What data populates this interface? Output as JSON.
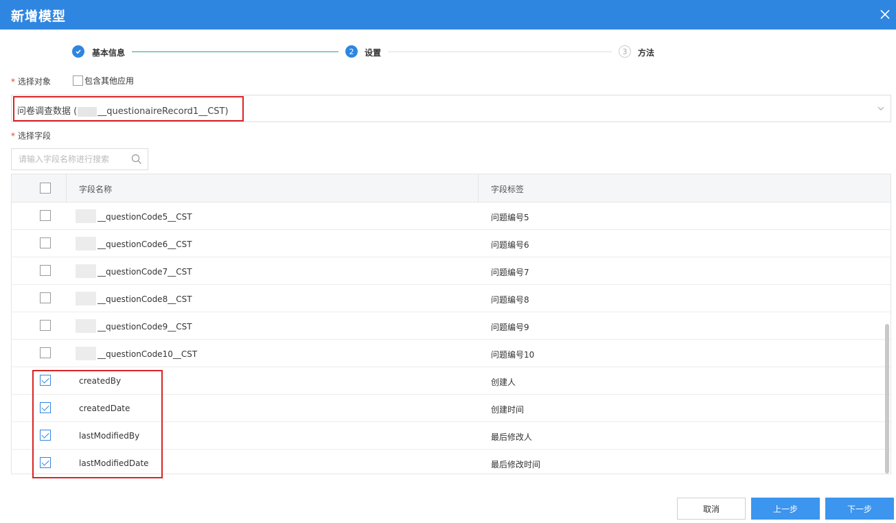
{
  "dialog": {
    "title": "新增模型"
  },
  "steps": [
    {
      "number": "1",
      "label": "基本信息",
      "state": "done"
    },
    {
      "number": "2",
      "label": "设置",
      "state": "active"
    },
    {
      "number": "3",
      "label": "方法",
      "state": "pending"
    }
  ],
  "object": {
    "label": "选择对象",
    "include_other_label": "包含其他应用",
    "select_prefix": "问卷调查数据 (",
    "select_suffix": "__questionaireRecord1__CST)"
  },
  "fields": {
    "label": "选择字段",
    "search_placeholder": "请输入字段名称进行搜索",
    "columns": {
      "name": "字段名称",
      "label": "字段标签"
    },
    "rows": [
      {
        "name": "__questionCode5__CST",
        "label": "问题编号5",
        "checked": false,
        "masked": true
      },
      {
        "name": "__questionCode6__CST",
        "label": "问题编号6",
        "checked": false,
        "masked": true
      },
      {
        "name": "__questionCode7__CST",
        "label": "问题编号7",
        "checked": false,
        "masked": true
      },
      {
        "name": "__questionCode8__CST",
        "label": "问题编号8",
        "checked": false,
        "masked": true
      },
      {
        "name": "__questionCode9__CST",
        "label": "问题编号9",
        "checked": false,
        "masked": true
      },
      {
        "name": "__questionCode10__CST",
        "label": "问题编号10",
        "checked": false,
        "masked": true
      },
      {
        "name": "createdBy",
        "label": "创建人",
        "checked": true,
        "masked": false
      },
      {
        "name": "createdDate",
        "label": "创建时间",
        "checked": true,
        "masked": false
      },
      {
        "name": "lastModifiedBy",
        "label": "最后修改人",
        "checked": true,
        "masked": false
      },
      {
        "name": "lastModifiedDate",
        "label": "最后修改时间",
        "checked": true,
        "masked": false
      }
    ]
  },
  "buttons": {
    "cancel": "取消",
    "prev": "上一步",
    "next": "下一步"
  },
  "colors": {
    "primary": "#2f86e0",
    "button": "#3c95ee",
    "highlight": "#d72323",
    "step_line_done": "#2aa198"
  }
}
